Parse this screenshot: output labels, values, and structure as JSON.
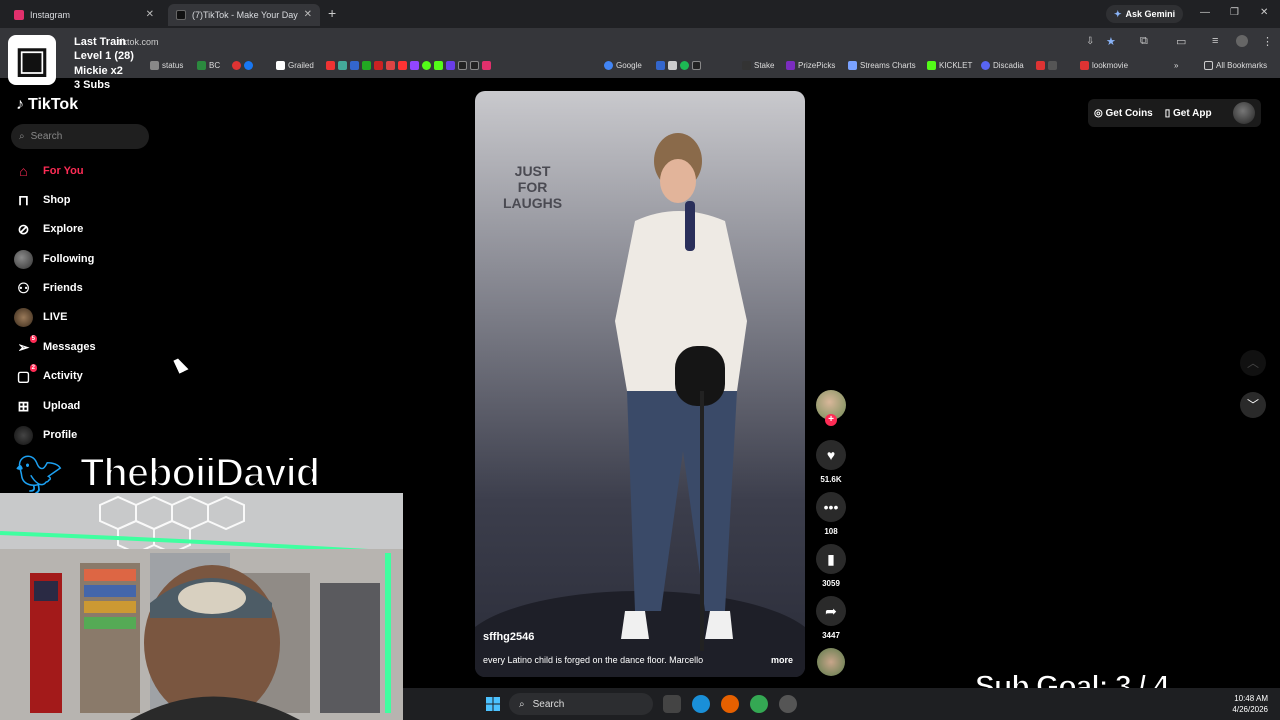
{
  "browser": {
    "tabs": [
      {
        "label": "Instagram",
        "color": "#e1306c"
      },
      {
        "label": "(7)TikTok - Make Your Day",
        "color": "#ffffff"
      }
    ],
    "url": "tiktok.com",
    "ask_gemini": "Ask Gemini",
    "bookmarks": [
      {
        "label": "status",
        "color": "#888"
      },
      {
        "label": "BC",
        "color": "#2b8a3e"
      },
      {
        "label": "Grailed",
        "color": "#fff"
      },
      {
        "label": "Google",
        "color": "#4285f4"
      },
      {
        "label": "Stake",
        "color": "#ccc"
      },
      {
        "label": "PrizePicks",
        "color": "#7b2cbf"
      },
      {
        "label": "Streams Charts",
        "color": "#7aa2ff"
      },
      {
        "label": "KICKLET",
        "color": "#53fc18"
      },
      {
        "label": "Discadia",
        "color": "#5865f2"
      },
      {
        "label": "lookmovie",
        "color": "#d33"
      }
    ],
    "all_bookmarks": "All Bookmarks"
  },
  "stream": {
    "train_title": "Last Train",
    "train_level": "Level 1  (28)",
    "train_user": "Mickie x2",
    "train_subs": "3 Subs",
    "twitter_name": "TheboiiDavid",
    "sub_goal": "Sub Goal:  3 / 4"
  },
  "tiktok": {
    "logo": "TikTok",
    "search_placeholder": "Search",
    "nav": [
      {
        "label": "For You",
        "icon": "home-icon",
        "active": true
      },
      {
        "label": "Shop",
        "icon": "shop-icon"
      },
      {
        "label": "Explore",
        "icon": "compass-icon"
      },
      {
        "label": "Following",
        "icon": "avatar"
      },
      {
        "label": "Friends",
        "icon": "friends-icon"
      },
      {
        "label": "LIVE",
        "icon": "live-icon"
      },
      {
        "label": "Messages",
        "icon": "send-icon",
        "badge": "5"
      },
      {
        "label": "Activity",
        "icon": "activity-icon",
        "badge": "2"
      },
      {
        "label": "Upload",
        "icon": "plus-square-icon"
      },
      {
        "label": "Profile",
        "icon": "avatar"
      }
    ],
    "accent": "#fe2c55",
    "get_coins": "Get Coins",
    "get_app": "Get App",
    "video": {
      "watermark": [
        "JUST",
        "FOR",
        "LAUGHS"
      ],
      "username": "sffhg2546",
      "caption": "every Latino child is forged on the dance floor. Marcello",
      "more": "more"
    },
    "actions": {
      "likes": "51.6K",
      "comments": "108",
      "saves": "3059",
      "shares": "3447"
    }
  },
  "taskbar": {
    "search": "Search",
    "time": "10:48 AM",
    "date": "4/26/2026"
  }
}
